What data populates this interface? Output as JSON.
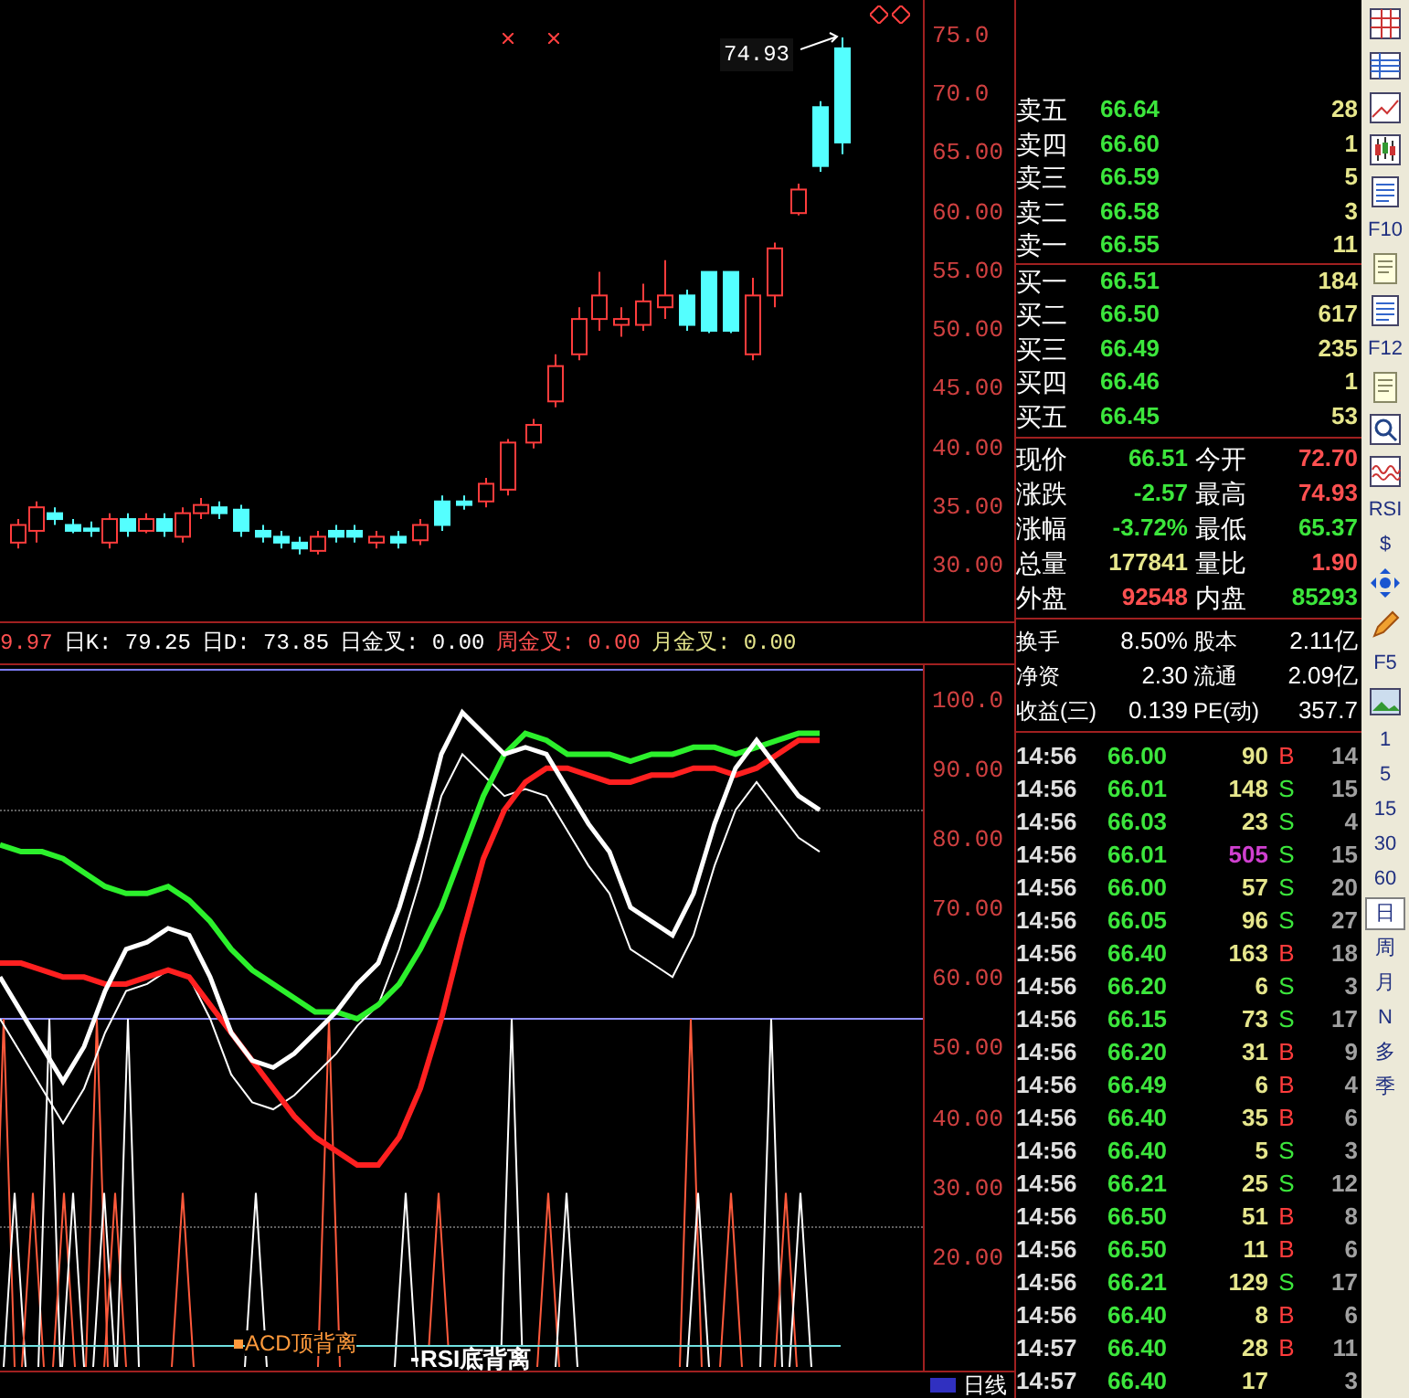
{
  "price_chart": {
    "high_label": "74.93",
    "axis_labels": [
      "75.0",
      "70.0",
      "65.00",
      "60.00",
      "55.00",
      "50.00",
      "45.00",
      "40.00",
      "35.00",
      "30.00"
    ]
  },
  "indicator_header": [
    {
      "text": "9.97",
      "color": "#ff5050"
    },
    {
      "text": "日K: 79.25",
      "color": "#ffffff"
    },
    {
      "text": "日D: 73.85",
      "color": "#ffffff"
    },
    {
      "text": "日金叉: 0.00",
      "color": "#ffffff"
    },
    {
      "text": "周金叉: 0.00",
      "color": "#ff5050"
    },
    {
      "text": "月金叉: 0.00",
      "color": "#e6e68c"
    }
  ],
  "indicator_chart": {
    "axis_labels": [
      "100.0",
      "90.00",
      "80.00",
      "70.00",
      "60.00",
      "50.00",
      "40.00",
      "30.00",
      "20.00"
    ],
    "signals": [
      {
        "text": "ACD顶背离",
        "color": "#ff9a3c"
      },
      {
        "text": "RSI底背离",
        "color": "#ffffff"
      }
    ]
  },
  "bottom_bar": {
    "label": "日线"
  },
  "order_book": [
    {
      "label": "卖五",
      "price": "66.64",
      "volume": "28"
    },
    {
      "label": "卖四",
      "price": "66.60",
      "volume": "1"
    },
    {
      "label": "卖三",
      "price": "66.59",
      "volume": "5"
    },
    {
      "label": "卖二",
      "price": "66.58",
      "volume": "3"
    },
    {
      "label": "卖一",
      "price": "66.55",
      "volume": "11"
    },
    {
      "label": "买一",
      "price": "66.51",
      "volume": "184"
    },
    {
      "label": "买二",
      "price": "66.50",
      "volume": "617"
    },
    {
      "label": "买三",
      "price": "66.49",
      "volume": "235"
    },
    {
      "label": "买四",
      "price": "66.46",
      "volume": "1"
    },
    {
      "label": "买五",
      "price": "66.45",
      "volume": "53"
    }
  ],
  "quote_stats": [
    {
      "left": {
        "label": "现价",
        "value": "66.51",
        "color": "#3ce63c"
      },
      "right": {
        "label": "今开",
        "value": "72.70",
        "color": "#ff5050"
      }
    },
    {
      "left": {
        "label": "涨跌",
        "value": "-2.57",
        "color": "#3ce63c"
      },
      "right": {
        "label": "最高",
        "value": "74.93",
        "color": "#ff5050"
      }
    },
    {
      "left": {
        "label": "涨幅",
        "value": "-3.72%",
        "color": "#3ce63c"
      },
      "right": {
        "label": "最低",
        "value": "65.37",
        "color": "#3ce63c"
      }
    },
    {
      "left": {
        "label": "总量",
        "value": "177841",
        "color": "#e6e68c"
      },
      "right": {
        "label": "量比",
        "value": "1.90",
        "color": "#ff5050"
      }
    },
    {
      "left": {
        "label": "外盘",
        "value": "92548",
        "color": "#ff5050"
      },
      "right": {
        "label": "内盘",
        "value": "85293",
        "color": "#3ce63c"
      }
    }
  ],
  "fundamentals": [
    {
      "label": "换手",
      "value": "8.50%",
      "label2": "股本",
      "value2": "2.11亿"
    },
    {
      "label": "净资",
      "value": "2.30",
      "label2": "流通",
      "value2": "2.09亿"
    },
    {
      "label": "收益(三)",
      "value": "0.139",
      "label2": "PE(动)",
      "value2": "357.7"
    }
  ],
  "trades": [
    {
      "time": "14:56",
      "price": "66.00",
      "volume": "90",
      "side": "B",
      "kind": "buy",
      "count": "14",
      "large": false
    },
    {
      "time": "14:56",
      "price": "66.01",
      "volume": "148",
      "side": "S",
      "kind": "sell",
      "count": "15",
      "large": false
    },
    {
      "time": "14:56",
      "price": "66.03",
      "volume": "23",
      "side": "S",
      "kind": "sell",
      "count": "4",
      "large": false
    },
    {
      "time": "14:56",
      "price": "66.01",
      "volume": "505",
      "side": "S",
      "kind": "sell",
      "count": "15",
      "large": true
    },
    {
      "time": "14:56",
      "price": "66.00",
      "volume": "57",
      "side": "S",
      "kind": "sell",
      "count": "20",
      "large": false
    },
    {
      "time": "14:56",
      "price": "66.05",
      "volume": "96",
      "side": "S",
      "kind": "sell",
      "count": "27",
      "large": false
    },
    {
      "time": "14:56",
      "price": "66.40",
      "volume": "163",
      "side": "B",
      "kind": "buy",
      "count": "18",
      "large": false
    },
    {
      "time": "14:56",
      "price": "66.20",
      "volume": "6",
      "side": "S",
      "kind": "sell",
      "count": "3",
      "large": false
    },
    {
      "time": "14:56",
      "price": "66.15",
      "volume": "73",
      "side": "S",
      "kind": "sell",
      "count": "17",
      "large": false
    },
    {
      "time": "14:56",
      "price": "66.20",
      "volume": "31",
      "side": "B",
      "kind": "buy",
      "count": "9",
      "large": false
    },
    {
      "time": "14:56",
      "price": "66.49",
      "volume": "6",
      "side": "B",
      "kind": "buy",
      "count": "4",
      "large": false
    },
    {
      "time": "14:56",
      "price": "66.40",
      "volume": "35",
      "side": "B",
      "kind": "buy",
      "count": "6",
      "large": false
    },
    {
      "time": "14:56",
      "price": "66.40",
      "volume": "5",
      "side": "S",
      "kind": "sell",
      "count": "3",
      "large": false
    },
    {
      "time": "14:56",
      "price": "66.21",
      "volume": "25",
      "side": "S",
      "kind": "sell",
      "count": "12",
      "large": false
    },
    {
      "time": "14:56",
      "price": "66.50",
      "volume": "51",
      "side": "B",
      "kind": "buy",
      "count": "8",
      "large": false
    },
    {
      "time": "14:56",
      "price": "66.50",
      "volume": "11",
      "side": "B",
      "kind": "buy",
      "count": "6",
      "large": false
    },
    {
      "time": "14:56",
      "price": "66.21",
      "volume": "129",
      "side": "S",
      "kind": "sell",
      "count": "17",
      "large": false
    },
    {
      "time": "14:56",
      "price": "66.40",
      "volume": "8",
      "side": "B",
      "kind": "buy",
      "count": "6",
      "large": false
    },
    {
      "time": "14:57",
      "price": "66.40",
      "volume": "28",
      "side": "B",
      "kind": "buy",
      "count": "11",
      "large": false
    },
    {
      "time": "14:57",
      "price": "66.40",
      "volume": "17",
      "kind": "none",
      "count": "3",
      "large": false
    }
  ],
  "toolbar": [
    {
      "kind": "grid",
      "selected": false
    },
    {
      "kind": "table",
      "selected": false
    },
    {
      "kind": "line",
      "selected": false
    },
    {
      "kind": "candle",
      "selected": false
    },
    {
      "kind": "list",
      "selected": false
    },
    {
      "kind": "text",
      "label": "F10",
      "selected": false
    },
    {
      "kind": "doc",
      "selected": false
    },
    {
      "kind": "list",
      "selected": false
    },
    {
      "kind": "text",
      "label": "F12",
      "selected": false
    },
    {
      "kind": "doc",
      "selected": false
    },
    {
      "kind": "search",
      "selected": false
    },
    {
      "kind": "wave",
      "selected": false
    },
    {
      "kind": "text",
      "label": "RSI",
      "selected": false
    },
    {
      "kind": "text",
      "label": "$",
      "selected": false
    },
    {
      "kind": "move",
      "selected": false
    },
    {
      "kind": "pencil",
      "selected": false
    },
    {
      "kind": "text",
      "label": "F5",
      "selected": false
    },
    {
      "kind": "image",
      "selected": false
    },
    {
      "kind": "text",
      "label": "1",
      "selected": false
    },
    {
      "kind": "text",
      "label": "5",
      "selected": false
    },
    {
      "kind": "text",
      "label": "15",
      "selected": false
    },
    {
      "kind": "text",
      "label": "30",
      "selected": false
    },
    {
      "kind": "text",
      "label": "60",
      "selected": false
    },
    {
      "kind": "text",
      "label": "日",
      "selected": true
    },
    {
      "kind": "text",
      "label": "周",
      "selected": false
    },
    {
      "kind": "text",
      "label": "月",
      "selected": false
    },
    {
      "kind": "text",
      "label": "N",
      "selected": false
    },
    {
      "kind": "text",
      "label": "多",
      "selected": false
    },
    {
      "kind": "text",
      "label": "季",
      "selected": false
    }
  ]
}
